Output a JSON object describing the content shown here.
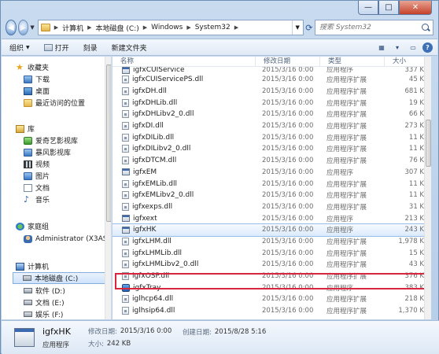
{
  "window": {
    "caption": {
      "minimize": "—",
      "maximize": "□",
      "close": "✕"
    }
  },
  "address": {
    "crumbs": [
      "计算机",
      "本地磁盘 (C:)",
      "Windows",
      "System32"
    ],
    "search_placeholder": "搜索 System32"
  },
  "toolbar": {
    "organize": "组织",
    "open": "打开",
    "burn": "刻录",
    "new_folder": "新建文件夹"
  },
  "nav": {
    "favorites": "收藏夹",
    "downloads": "下载",
    "desktop": "桌面",
    "recent": "最近访问的位置",
    "libraries": "库",
    "iqiyi": "爱奇艺影视库",
    "baofeng": "暴风影视库",
    "videos": "视频",
    "pictures": "图片",
    "documents": "文档",
    "music": "音乐",
    "homegroup": "家庭组",
    "admin": "Administrator (X3ASF",
    "computer": "计算机",
    "drive_c": "本地磁盘 (C:)",
    "drive_d": "软件 (D:)",
    "drive_e": "文档 (E:)",
    "drive_f": "娱乐 (F:)"
  },
  "columns": {
    "name": "名称",
    "date": "修改日期",
    "type": "类型",
    "size": "大小"
  },
  "files": [
    {
      "name": "igfxCUIService",
      "date": "2015/3/16 0:00",
      "type": "应用程序",
      "size": "337 K",
      "icon": "exe"
    },
    {
      "name": "igfxCUIServicePS.dll",
      "date": "2015/3/16 0:00",
      "type": "应用程序扩展",
      "size": "45 K",
      "icon": "dll"
    },
    {
      "name": "igfxDH.dll",
      "date": "2015/3/16 0:00",
      "type": "应用程序扩展",
      "size": "681 K",
      "icon": "dll"
    },
    {
      "name": "igfxDHLib.dll",
      "date": "2015/3/16 0:00",
      "type": "应用程序扩展",
      "size": "19 K",
      "icon": "dll"
    },
    {
      "name": "igfxDHLibv2_0.dll",
      "date": "2015/3/16 0:00",
      "type": "应用程序扩展",
      "size": "66 K",
      "icon": "dll"
    },
    {
      "name": "igfxDI.dll",
      "date": "2015/3/16 0:00",
      "type": "应用程序扩展",
      "size": "273 K",
      "icon": "dll"
    },
    {
      "name": "igfxDILib.dll",
      "date": "2015/3/16 0:00",
      "type": "应用程序扩展",
      "size": "11 K",
      "icon": "dll"
    },
    {
      "name": "igfxDILibv2_0.dll",
      "date": "2015/3/16 0:00",
      "type": "应用程序扩展",
      "size": "11 K",
      "icon": "dll"
    },
    {
      "name": "igfxDTCM.dll",
      "date": "2015/3/16 0:00",
      "type": "应用程序扩展",
      "size": "76 K",
      "icon": "dll"
    },
    {
      "name": "igfxEM",
      "date": "2015/3/16 0:00",
      "type": "应用程序",
      "size": "307 K",
      "icon": "exe"
    },
    {
      "name": "igfxEMLib.dll",
      "date": "2015/3/16 0:00",
      "type": "应用程序扩展",
      "size": "11 K",
      "icon": "dll"
    },
    {
      "name": "igfxEMLibv2_0.dll",
      "date": "2015/3/16 0:00",
      "type": "应用程序扩展",
      "size": "11 K",
      "icon": "dll"
    },
    {
      "name": "igfxexps.dll",
      "date": "2015/3/16 0:00",
      "type": "应用程序扩展",
      "size": "31 K",
      "icon": "dll"
    },
    {
      "name": "igfxext",
      "date": "2015/3/16 0:00",
      "type": "应用程序",
      "size": "213 K",
      "icon": "exe"
    },
    {
      "name": "igfxHK",
      "date": "2015/3/16 0:00",
      "type": "应用程序",
      "size": "243 K",
      "icon": "exe"
    },
    {
      "name": "igfxLHM.dll",
      "date": "2015/3/16 0:00",
      "type": "应用程序扩展",
      "size": "1,978 K",
      "icon": "dll"
    },
    {
      "name": "igfxLHMLib.dll",
      "date": "2015/3/16 0:00",
      "type": "应用程序扩展",
      "size": "15 K",
      "icon": "dll"
    },
    {
      "name": "igfxLHMLibv2_0.dll",
      "date": "2015/3/16 0:00",
      "type": "应用程序扩展",
      "size": "43 K",
      "icon": "dll"
    },
    {
      "name": "igfxOSP.dll",
      "date": "2015/3/16 0:00",
      "type": "应用程序扩展",
      "size": "376 K",
      "icon": "dll"
    },
    {
      "name": "igfxTray",
      "date": "2015/3/16 0:00",
      "type": "应用程序",
      "size": "383 K",
      "icon": "tray"
    },
    {
      "name": "iglhcp64.dll",
      "date": "2015/3/16 0:00",
      "type": "应用程序扩展",
      "size": "218 K",
      "icon": "dll"
    },
    {
      "name": "iglhsip64.dll",
      "date": "2015/3/16 0:00",
      "type": "应用程序扩展",
      "size": "1,370 K",
      "icon": "dll"
    }
  ],
  "details": {
    "name": "igfxHK",
    "modified_label": "修改日期:",
    "modified": "2015/3/16 0:00",
    "created_label": "创建日期:",
    "created": "2015/8/28 5:16",
    "type": "应用程序",
    "size_label": "大小:",
    "size": "242 KB"
  }
}
